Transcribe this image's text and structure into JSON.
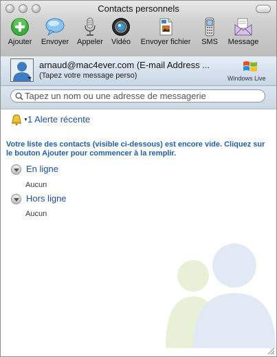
{
  "window": {
    "title": "Contacts personnels"
  },
  "toolbar": {
    "items": [
      {
        "label": "Ajouter",
        "icon": "add-icon"
      },
      {
        "label": "Envoyer",
        "icon": "chat-bubble-icon"
      },
      {
        "label": "Appeler",
        "icon": "microphone-icon"
      },
      {
        "label": "Vidéo",
        "icon": "webcam-icon"
      },
      {
        "label": "Envoyer fichier",
        "icon": "send-file-icon"
      },
      {
        "label": "SMS",
        "icon": "phone-icon"
      },
      {
        "label": "Message",
        "icon": "envelope-icon"
      }
    ]
  },
  "profile": {
    "name": "arnaud@mac4ever.com (E-mail Address ...",
    "personal_message": "(Tapez votre message perso)",
    "brand": "Windows Live"
  },
  "search": {
    "placeholder": "Tapez un nom ou une adresse de messagerie"
  },
  "alerts": {
    "label": "1 Alerte récente"
  },
  "contacts": {
    "empty_hint": "Votre liste des contacts (visible ci-dessous) est encore vide. Cliquez sur le bouton Ajouter pour commencer à la remplir.",
    "groups": [
      {
        "label": "En ligne",
        "empty_text": "Aucun"
      },
      {
        "label": "Hors ligne",
        "empty_text": "Aucun"
      }
    ]
  },
  "colors": {
    "link": "#1f4d99",
    "hint": "#1f5ea8",
    "accent_green": "#3cae3a"
  }
}
